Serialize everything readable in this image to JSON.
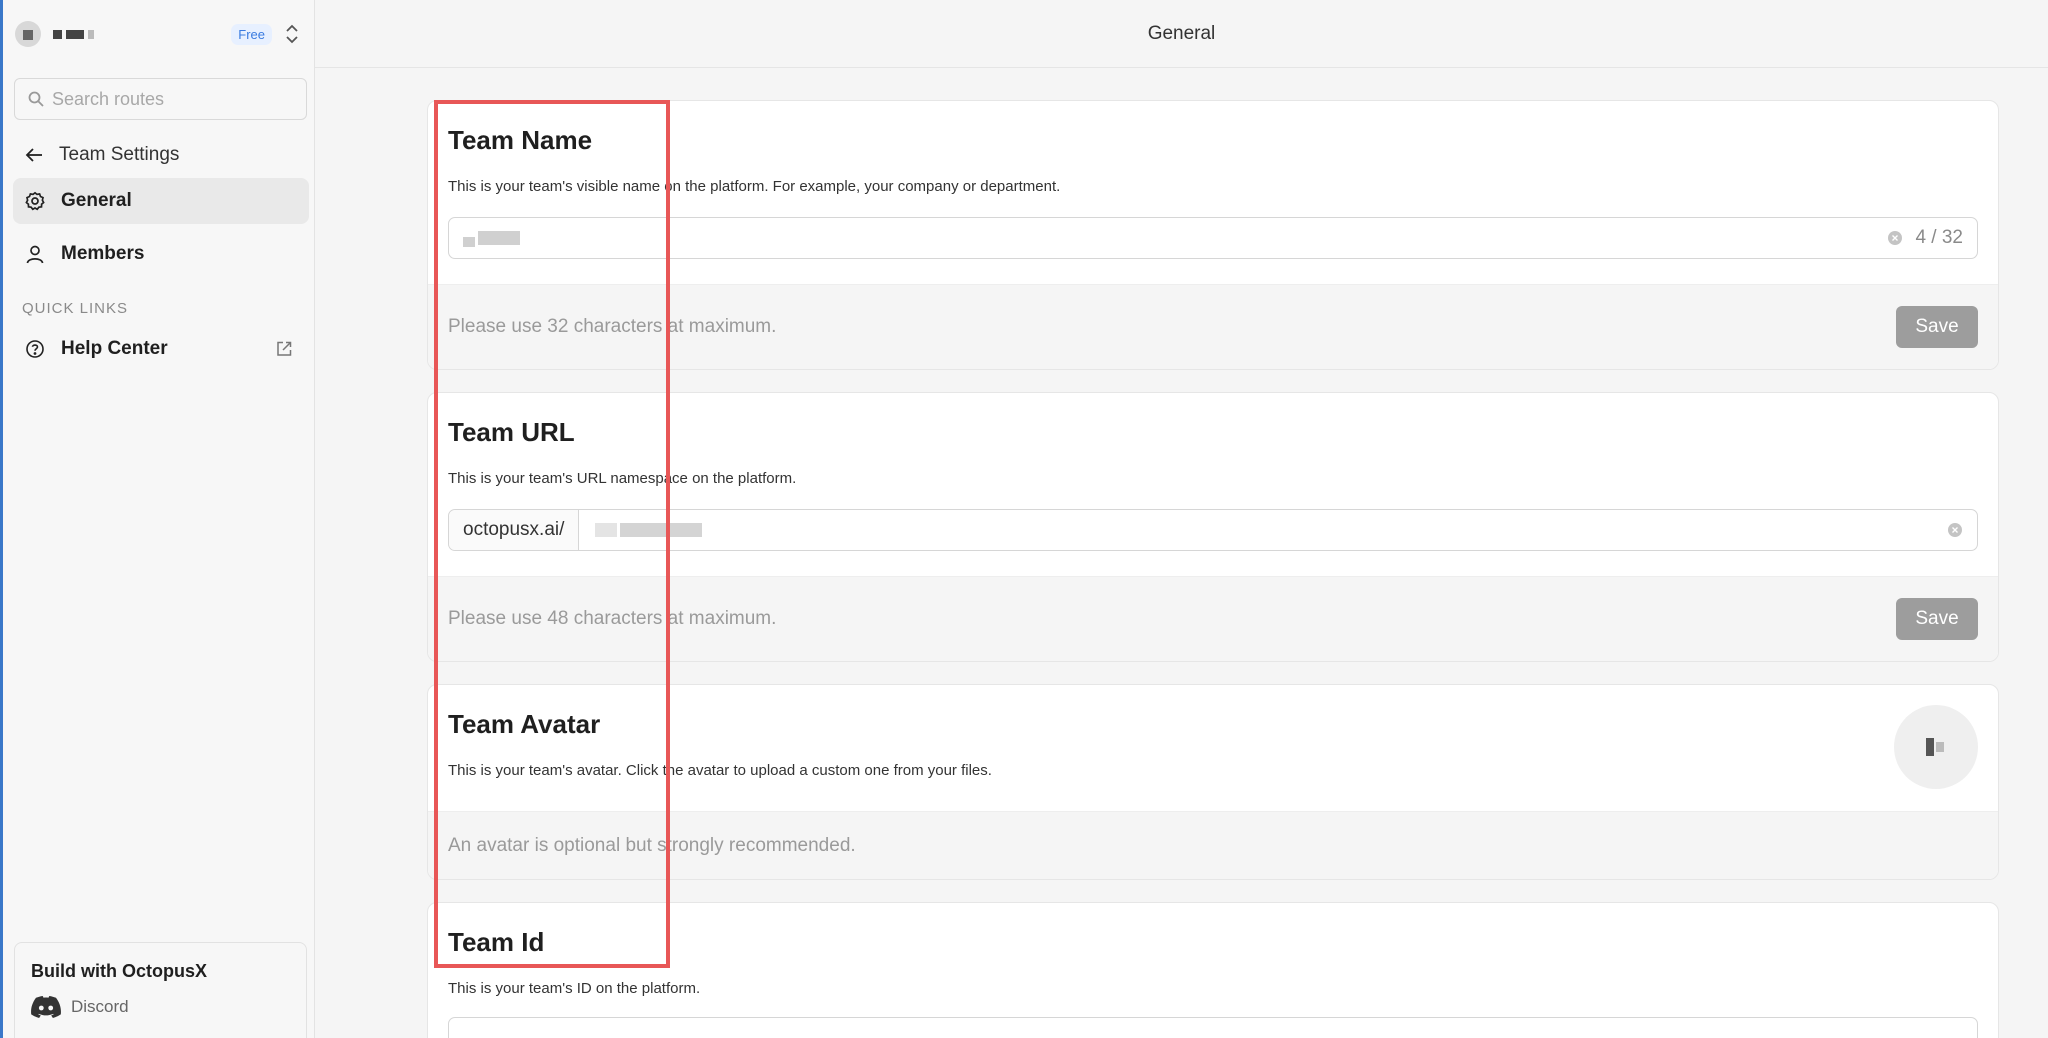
{
  "sidebar": {
    "workspace_badge": "Free",
    "search_placeholder": "Search routes",
    "back_label": "Team Settings",
    "nav": [
      {
        "label": "General"
      },
      {
        "label": "Members"
      }
    ],
    "quick_links_label": "QUICK LINKS",
    "help_center": "Help Center",
    "build_title": "Build with OctopusX",
    "discord": "Discord"
  },
  "header": {
    "title": "General"
  },
  "cards": {
    "name": {
      "title": "Team Name",
      "desc": "This is your team's visible name on the platform. For example, your company or department.",
      "counter": "4 / 32",
      "hint": "Please use 32 characters at maximum.",
      "save": "Save"
    },
    "url": {
      "title": "Team URL",
      "desc": "This is your team's URL namespace on the platform.",
      "prefix": "octopusx.ai/",
      "hint": "Please use 48 characters at maximum.",
      "save": "Save"
    },
    "avatar": {
      "title": "Team Avatar",
      "desc": "This is your team's avatar. Click the avatar to upload a custom one from your files.",
      "hint": "An avatar is optional but strongly recommended."
    },
    "id": {
      "title": "Team Id",
      "desc": "This is your team's ID on the platform."
    }
  },
  "colors": {
    "highlight": "#e85757",
    "accent_blue": "#3a7be0",
    "save_button": "#9d9d9d"
  }
}
